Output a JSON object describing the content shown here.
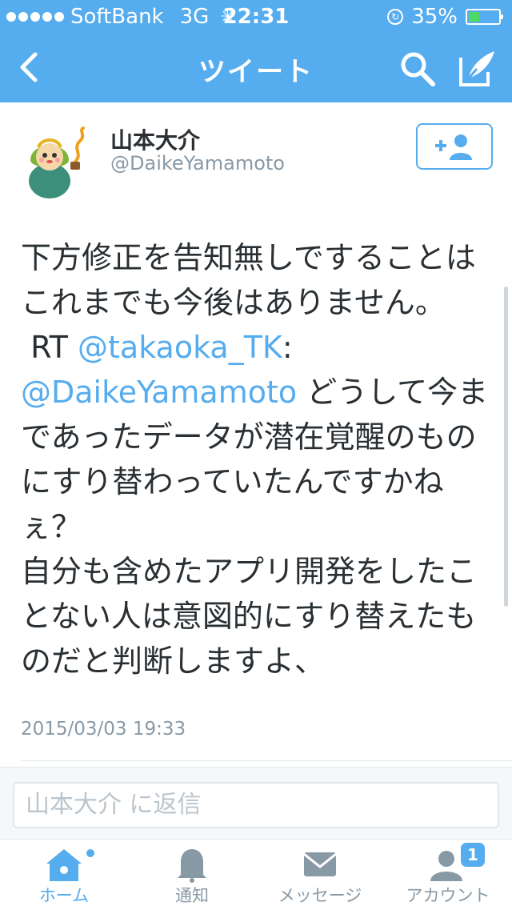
{
  "status_bar": {
    "carrier": "SoftBank",
    "network": "3G",
    "time": "22:31",
    "battery_percent": "35%",
    "battery_level": 0.35,
    "battery_color": "#4cd964"
  },
  "nav": {
    "title": "ツイート",
    "back_icon": "chevron-left-icon",
    "search_icon": "search-icon",
    "compose_icon": "compose-icon"
  },
  "tweet": {
    "author_name": "山本大介",
    "author_handle": "@DaikeYamamoto",
    "follow_icon": "add-user-icon",
    "text_part1": "下方修正を告知無しですることはこれまでも今後はありません。\n RT ",
    "mention1": "@takaoka_TK",
    "text_part2": ":\n",
    "mention2": "@DaikeYamamoto",
    "text_part3": " どうして今まであったデータが潜在覚醒のものにすり替わっていたんですかねぇ？\n自分も含めたアプリ開発をしたことない人は意図的にすり替えたものだと判断しますよ、",
    "timestamp": "2015/03/03 19:33"
  },
  "reply": {
    "placeholder": "山本大介 に返信"
  },
  "tabs": [
    {
      "label": "ホーム",
      "icon": "home-icon",
      "active": true
    },
    {
      "label": "通知",
      "icon": "bell-icon",
      "active": false
    },
    {
      "label": "メッセージ",
      "icon": "envelope-icon",
      "active": false
    },
    {
      "label": "アカウント",
      "icon": "account-icon",
      "active": false,
      "badge": "1"
    }
  ],
  "colors": {
    "accent": "#55acee",
    "text": "#292f33",
    "muted": "#8899a6"
  }
}
